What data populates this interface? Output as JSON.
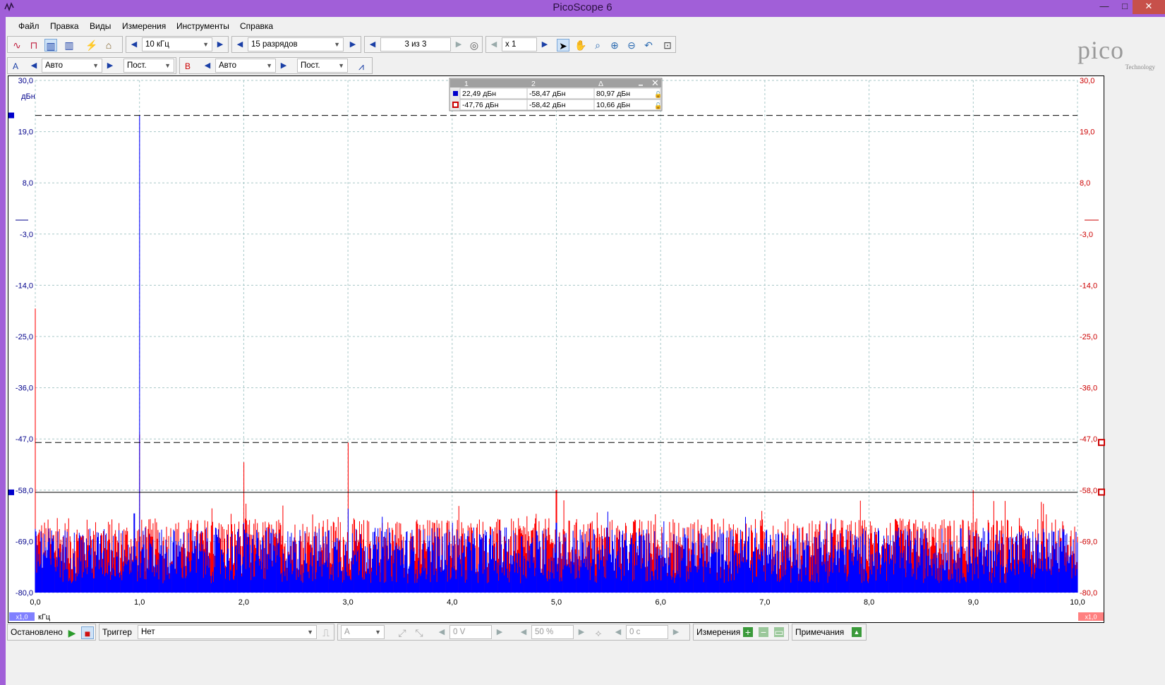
{
  "window": {
    "title": "PicoScope 6",
    "minimize": "—",
    "maximize": "□",
    "close": "✕"
  },
  "menu": [
    "Файл",
    "Правка",
    "Виды",
    "Измерения",
    "Инструменты",
    "Справка"
  ],
  "toolbar": {
    "timebase": "10 кГц",
    "resolution": "15 разрядов",
    "buffer": "3 из 3",
    "zoom": "x 1"
  },
  "channel_a": {
    "label": "A",
    "range": "Авто",
    "coupling": "Пост."
  },
  "channel_b": {
    "label": "B",
    "range": "Авто",
    "coupling": "Пост."
  },
  "logo": {
    "brand": "pico",
    "sub": "Technology"
  },
  "rulers_table": {
    "headers": [
      "1",
      "2",
      "Δ"
    ],
    "rows": [
      {
        "ch": "A",
        "v1": "22,49 дБн",
        "v2": "-58,47 дБн",
        "delta": "80,97 дБн"
      },
      {
        "ch": "B",
        "v1": "-47,76 дБн",
        "v2": "-58,42 дБн",
        "delta": "10,66 дБн"
      }
    ]
  },
  "axis_labels": {
    "y_unit": "дБн",
    "x_unit": "кГц",
    "left_scale": "x1,0",
    "right_scale": "x1,0",
    "y_ticks": [
      "30,0",
      "19,0",
      "8,0",
      "-3,0",
      "-14,0",
      "-25,0",
      "-36,0",
      "-47,0",
      "-58,0",
      "-69,0",
      "-80,0"
    ],
    "x_ticks": [
      "0,0",
      "1,0",
      "2,0",
      "3,0",
      "4,0",
      "5,0",
      "6,0",
      "7,0",
      "8,0",
      "9,0",
      "10,0"
    ]
  },
  "chart_data": {
    "type": "line",
    "x_unit": "кГц",
    "y_unit": "дБн",
    "xlim": [
      0,
      10
    ],
    "ylim": [
      -80,
      30
    ],
    "grid": true,
    "series": [
      {
        "channel": "A",
        "color": "#0000ff",
        "noise_floor": -72,
        "peaks": [
          [
            0.0,
            -70
          ],
          [
            0.95,
            -63
          ],
          [
            1.0,
            22.49
          ],
          [
            2.0,
            -65
          ],
          [
            3.0,
            -62
          ],
          [
            4.0,
            -65
          ],
          [
            5.0,
            -65
          ],
          [
            9.0,
            -67
          ]
        ]
      },
      {
        "channel": "B",
        "color": "#ff0000",
        "noise_floor": -70,
        "peaks": [
          [
            0.0,
            -19
          ],
          [
            1.0,
            -46
          ],
          [
            2.0,
            -52
          ],
          [
            3.0,
            -47.76
          ],
          [
            4.0,
            -66
          ],
          [
            5.0,
            -58
          ],
          [
            9.0,
            -58
          ]
        ]
      }
    ],
    "rulers": {
      "A": [
        22.49,
        -58.47
      ],
      "B": [
        -47.76,
        -58.42
      ]
    }
  },
  "status": {
    "state": "Остановлено",
    "trigger_label": "Триггер",
    "trigger_mode": "Нет",
    "trigger_channel": "A",
    "threshold": "0 V",
    "pretrigger": "50 %",
    "delay": "0 с",
    "measurements": "Измерения",
    "notes": "Примечания"
  },
  "colors": {
    "accent": "#a15fd8",
    "ch_a": "#0000ff",
    "ch_b": "#ff0000"
  }
}
